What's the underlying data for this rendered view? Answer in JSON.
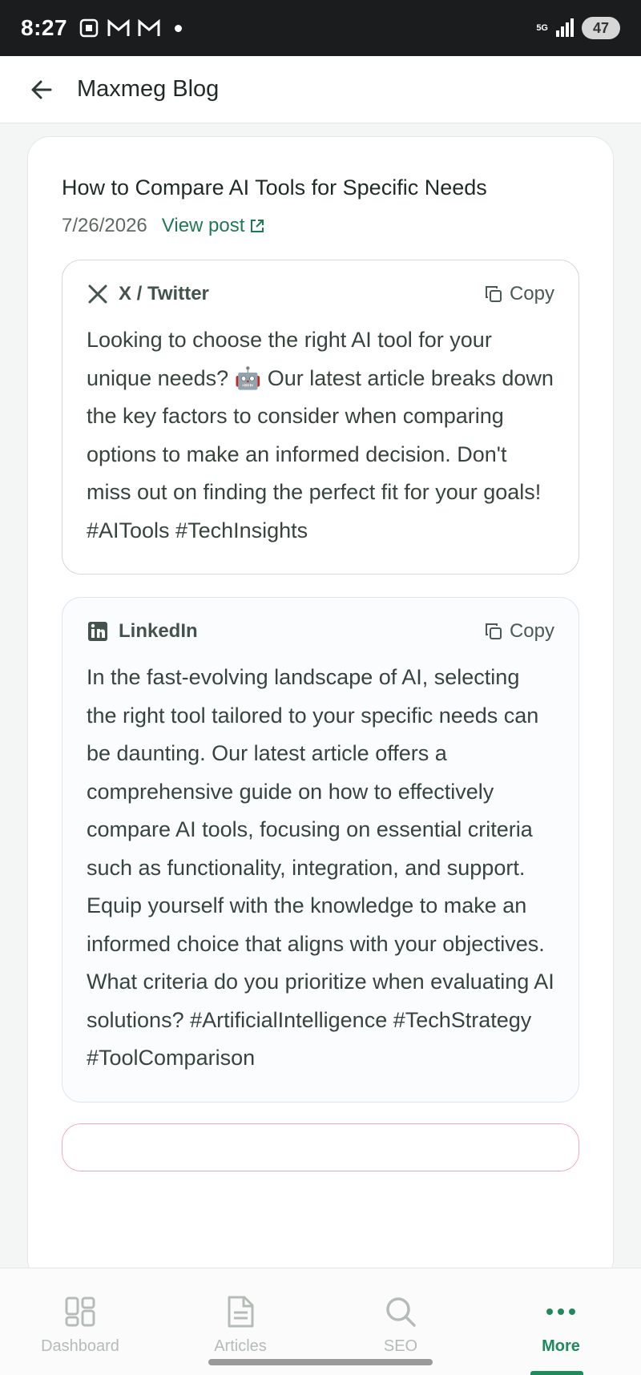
{
  "status": {
    "time": "8:27",
    "battery": "47",
    "network": "5G"
  },
  "app_bar": {
    "title": "Maxmeg Blog"
  },
  "post": {
    "title": "How to Compare AI Tools for Specific Needs",
    "date": "7/26/2026",
    "view_post_label": "View post"
  },
  "social_posts": [
    {
      "platform": "X / Twitter",
      "icon": "x-logo-icon",
      "copy_label": "Copy",
      "text": "Looking to choose the right AI tool for your unique needs? 🤖 Our latest article breaks down the key factors to consider when comparing options to make an informed decision. Don't miss out on finding the perfect fit for your goals! #AITools #TechInsights"
    },
    {
      "platform": "LinkedIn",
      "icon": "linkedin-icon",
      "copy_label": "Copy",
      "text": "In the fast-evolving landscape of AI, selecting the right tool tailored to your specific needs can be daunting. Our latest article offers a comprehensive guide on how to effectively compare AI tools, focusing on essential criteria such as functionality, integration, and support. Equip yourself with the knowledge to make an informed choice that aligns with your objectives. What criteria do you prioritize when evaluating AI solutions? #ArtificialIntelligence #TechStrategy #ToolComparison"
    }
  ],
  "bottom_nav": {
    "items": [
      {
        "label": "Dashboard",
        "icon": "dashboard-grid-icon",
        "active": false
      },
      {
        "label": "Articles",
        "icon": "document-icon",
        "active": false
      },
      {
        "label": "SEO",
        "icon": "search-icon",
        "active": false
      },
      {
        "label": "More",
        "icon": "more-dots-icon",
        "active": true
      }
    ]
  },
  "colors": {
    "accent": "#1f8a5c",
    "link": "#1f7a54",
    "status_bar": "#1b1c1e"
  }
}
